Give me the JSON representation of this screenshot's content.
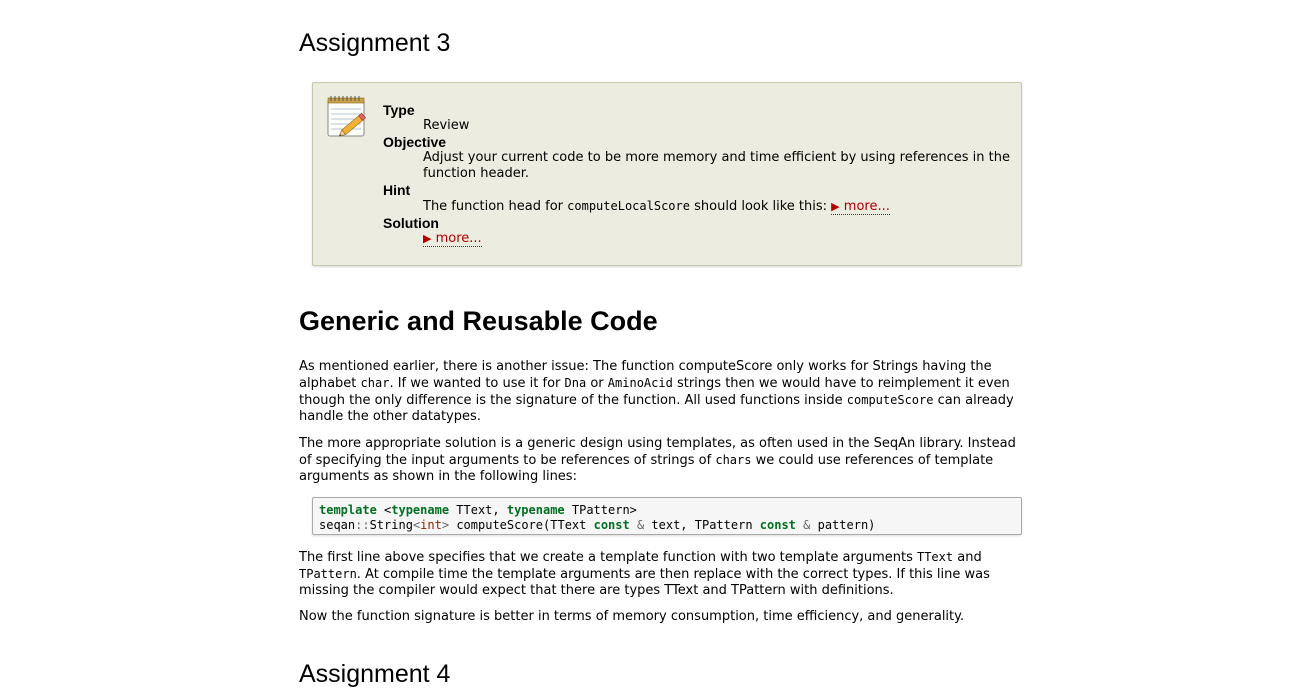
{
  "assignment3": {
    "title": "Assignment 3",
    "type_label": "Type",
    "type_value": "Review",
    "objective_label": "Objective",
    "objective_value": "Adjust your current code to be more memory and time efficient by using references in the function header.",
    "hint_label": "Hint",
    "hint_prefix": "The function head for",
    "hint_code": "computeLocalScore",
    "hint_suffix": "should look like this:",
    "hint_more": "more...",
    "solution_label": "Solution",
    "solution_more": "more..."
  },
  "section": {
    "title": "Generic and Reusable Code"
  },
  "para1": {
    "t1": "As mentioned earlier, there is another issue: The function computeScore only works for Strings having the alphabet",
    "c1": "char",
    "t2": ". If we wanted to use it for",
    "c2": "Dna",
    "t3": "or",
    "c3": "AminoAcid",
    "t4": "strings then we would have to reimplement it even though the only difference is the signature of the function. All used functions inside",
    "c4": "computeScore",
    "t5": "can already handle the other datatypes."
  },
  "para2": {
    "t1": "The more appropriate solution is a generic design using templates, as often used in the SeqAn library. Instead of specifying the input arguments to be references of strings of",
    "c1": "chars",
    "t2": "we could use references of template arguments as shown in the following lines:"
  },
  "code": {
    "line1": {
      "k1": "template",
      "p1": " <",
      "k2": "typename",
      "p2": " TText, ",
      "k3": "typename",
      "p3": " TPattern>"
    },
    "line2": {
      "p1": "seqan",
      "o1": "::",
      "p2": "String",
      "o2": "<",
      "t1": "int",
      "o3": ">",
      "p3": " computeScore(TText ",
      "k1": "const",
      "p4": " ",
      "o4": "&",
      "p5": " text, TPattern ",
      "k2": "const",
      "p6": " ",
      "o5": "&",
      "p7": " pattern)"
    }
  },
  "para3": {
    "t1": "The first line above specifies that we create a template function with two template arguments",
    "c1": "TText",
    "t2": "and",
    "c2": "TPattern",
    "t3": ". At compile time the template arguments are then replace with the correct types. If this line was missing the compiler would expect that there are types TText and TPattern with definitions."
  },
  "para4": {
    "text": "Now the function signature is better in terms of memory consumption, time efficiency, and generality."
  },
  "assignment4": {
    "title": "Assignment 4"
  },
  "icons": {
    "assignment": "notepad-pencil-icon",
    "more": "triangle-right-icon"
  },
  "colors": {
    "box_bg": "#ecece0",
    "more_link": "#b00000",
    "keyword": "#007020",
    "type": "#902000"
  }
}
